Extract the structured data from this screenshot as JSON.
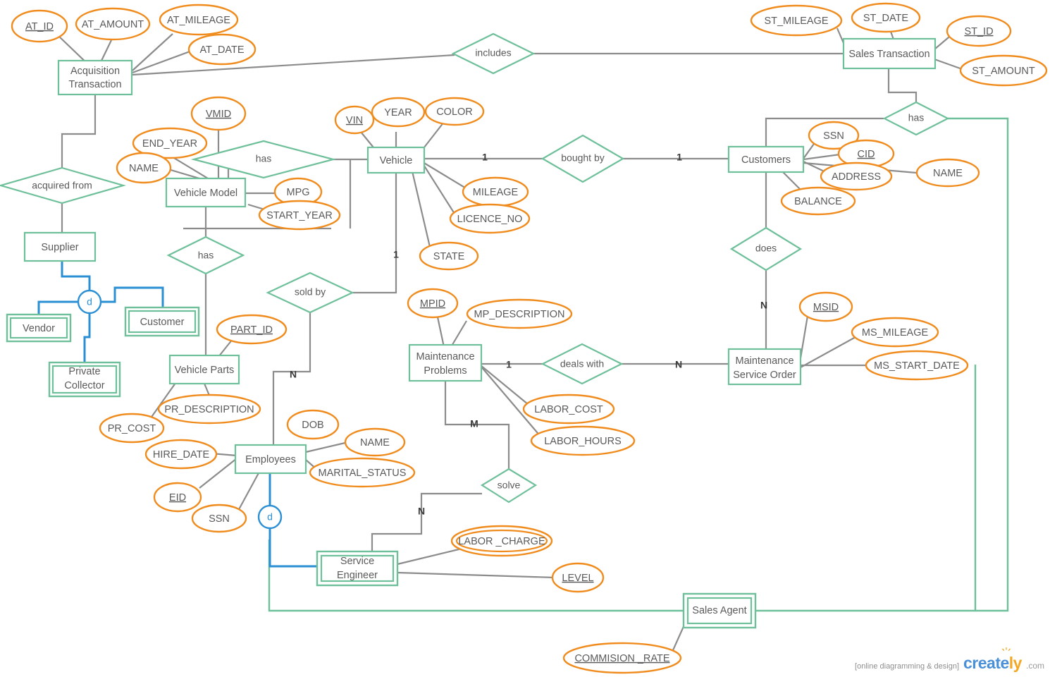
{
  "diagram": {
    "title": "Vehicle Dealership ER Diagram",
    "colors": {
      "entity_stroke": "#6ec09a",
      "attribute_stroke": "#f08c1e",
      "connector": "#8c8c8c",
      "specialization": "#2b8fd4",
      "text": "#5a5a5a"
    },
    "entities": [
      {
        "id": "acquisition_transaction",
        "label": "Acquisition\nTransaction",
        "line1": "Acquisition",
        "line2": "Transaction",
        "weak": false
      },
      {
        "id": "sales_transaction",
        "label": "Sales Transaction",
        "line1": "Sales Transaction",
        "line2": "",
        "weak": false
      },
      {
        "id": "vehicle_model",
        "label": "Vehicle Model",
        "line1": "Vehicle Model",
        "line2": "",
        "weak": false
      },
      {
        "id": "vehicle",
        "label": "Vehicle",
        "line1": "Vehicle",
        "line2": "",
        "weak": false
      },
      {
        "id": "customers",
        "label": "Customers",
        "line1": "Customers",
        "line2": "",
        "weak": false
      },
      {
        "id": "supplier",
        "label": "Supplier",
        "line1": "Supplier",
        "line2": "",
        "weak": false
      },
      {
        "id": "vendor",
        "label": "Vendor",
        "line1": "Vendor",
        "line2": "",
        "weak": true
      },
      {
        "id": "customer",
        "label": "Customer",
        "line1": "Customer",
        "line2": "",
        "weak": true
      },
      {
        "id": "private_collector",
        "label": "Private\nCollector",
        "line1": "Private",
        "line2": "Collector",
        "weak": true
      },
      {
        "id": "vehicle_parts",
        "label": "Vehicle Parts",
        "line1": "Vehicle Parts",
        "line2": "",
        "weak": false
      },
      {
        "id": "employees",
        "label": "Employees",
        "line1": "Employees",
        "line2": "",
        "weak": false
      },
      {
        "id": "maintenance_problems",
        "label": "Maintenance\nProblems",
        "line1": "Maintenance",
        "line2": "Problems",
        "weak": false
      },
      {
        "id": "maintenance_service_order",
        "label": "Maintenance\nService Order",
        "line1": "Maintenance",
        "line2": "Service Order",
        "weak": false
      },
      {
        "id": "service_engineer",
        "label": "Service\nEngineer",
        "line1": "Service",
        "line2": "Engineer",
        "weak": true
      },
      {
        "id": "sales_agent",
        "label": "Sales Agent",
        "line1": "Sales Agent",
        "line2": "",
        "weak": true
      }
    ],
    "relationships": [
      {
        "id": "includes",
        "label": "includes"
      },
      {
        "id": "has_sales_customers",
        "label": "has"
      },
      {
        "id": "acquired_from",
        "label": "acquired from"
      },
      {
        "id": "has_model_vehicle",
        "label": "has"
      },
      {
        "id": "bought_by",
        "label": "bought by"
      },
      {
        "id": "has_model_parts",
        "label": "has"
      },
      {
        "id": "sold_by",
        "label": "sold by"
      },
      {
        "id": "does",
        "label": "does"
      },
      {
        "id": "deals_with",
        "label": "deals with"
      },
      {
        "id": "solve",
        "label": "solve"
      }
    ],
    "attributes": [
      {
        "id": "at_id",
        "label": "AT_ID",
        "key": true,
        "multivalued": false,
        "owner": "acquisition_transaction"
      },
      {
        "id": "at_amount",
        "label": "AT_AMOUNT",
        "key": false,
        "multivalued": false,
        "owner": "acquisition_transaction"
      },
      {
        "id": "at_mileage",
        "label": "AT_MILEAGE",
        "key": false,
        "multivalued": false,
        "owner": "acquisition_transaction"
      },
      {
        "id": "at_date",
        "label": "AT_DATE",
        "key": false,
        "multivalued": false,
        "owner": "acquisition_transaction"
      },
      {
        "id": "st_mileage",
        "label": "ST_MILEAGE",
        "key": false,
        "multivalued": false,
        "owner": "sales_transaction"
      },
      {
        "id": "st_date",
        "label": "ST_DATE",
        "key": false,
        "multivalued": false,
        "owner": "sales_transaction"
      },
      {
        "id": "st_id",
        "label": "ST_ID",
        "key": true,
        "multivalued": false,
        "owner": "sales_transaction"
      },
      {
        "id": "st_amount",
        "label": "ST_AMOUNT",
        "key": false,
        "multivalued": false,
        "owner": "sales_transaction"
      },
      {
        "id": "vmid",
        "label": "VMID",
        "key": true,
        "multivalued": false,
        "owner": "vehicle_model"
      },
      {
        "id": "end_year",
        "label": "END_YEAR",
        "key": false,
        "multivalued": false,
        "owner": "vehicle_model"
      },
      {
        "id": "name_vm",
        "label": "NAME",
        "key": false,
        "multivalued": false,
        "owner": "vehicle_model"
      },
      {
        "id": "mpg",
        "label": "MPG",
        "key": false,
        "multivalued": false,
        "owner": "vehicle_model"
      },
      {
        "id": "start_year",
        "label": "START_YEAR",
        "key": false,
        "multivalued": false,
        "owner": "vehicle_model"
      },
      {
        "id": "vin",
        "label": "VIN",
        "key": true,
        "multivalued": false,
        "owner": "vehicle"
      },
      {
        "id": "year",
        "label": "YEAR",
        "key": false,
        "multivalued": false,
        "owner": "vehicle"
      },
      {
        "id": "color",
        "label": "COLOR",
        "key": false,
        "multivalued": false,
        "owner": "vehicle"
      },
      {
        "id": "mileage",
        "label": "MILEAGE",
        "key": false,
        "multivalued": false,
        "owner": "vehicle"
      },
      {
        "id": "licence_no",
        "label": "LICENCE_NO",
        "key": false,
        "multivalued": false,
        "owner": "vehicle"
      },
      {
        "id": "state",
        "label": "STATE",
        "key": false,
        "multivalued": false,
        "owner": "vehicle"
      },
      {
        "id": "ssn_cust",
        "label": "SSN",
        "key": false,
        "multivalued": false,
        "owner": "customers"
      },
      {
        "id": "cid",
        "label": "CID",
        "key": true,
        "multivalued": false,
        "owner": "customers"
      },
      {
        "id": "address",
        "label": "ADDRESS",
        "key": false,
        "multivalued": false,
        "owner": "customers"
      },
      {
        "id": "name_cust",
        "label": "NAME",
        "key": false,
        "multivalued": false,
        "owner": "customers"
      },
      {
        "id": "balance",
        "label": "BALANCE",
        "key": false,
        "multivalued": false,
        "owner": "customers"
      },
      {
        "id": "part_id",
        "label": "PART_ID",
        "key": true,
        "multivalued": false,
        "owner": "vehicle_parts"
      },
      {
        "id": "pr_description",
        "label": "PR_DESCRIPTION",
        "key": false,
        "multivalued": false,
        "owner": "vehicle_parts"
      },
      {
        "id": "pr_cost",
        "label": "PR_COST",
        "key": false,
        "multivalued": false,
        "owner": "vehicle_parts"
      },
      {
        "id": "dob",
        "label": "DOB",
        "key": false,
        "multivalued": false,
        "owner": "employees"
      },
      {
        "id": "name_emp",
        "label": "NAME",
        "key": false,
        "multivalued": false,
        "owner": "employees"
      },
      {
        "id": "marital_status",
        "label": "MARITAL_STATUS",
        "key": false,
        "multivalued": false,
        "owner": "employees"
      },
      {
        "id": "hire_date",
        "label": "HIRE_DATE",
        "key": false,
        "multivalued": false,
        "owner": "employees"
      },
      {
        "id": "eid",
        "label": "EID",
        "key": true,
        "multivalued": false,
        "owner": "employees"
      },
      {
        "id": "ssn_emp",
        "label": "SSN",
        "key": false,
        "multivalued": false,
        "owner": "employees"
      },
      {
        "id": "mpid",
        "label": "MPID",
        "key": true,
        "multivalued": false,
        "owner": "maintenance_problems"
      },
      {
        "id": "mp_description",
        "label": "MP_DESCRIPTION",
        "key": false,
        "multivalued": false,
        "owner": "maintenance_problems"
      },
      {
        "id": "labor_cost",
        "label": "LABOR_COST",
        "key": false,
        "multivalued": false,
        "owner": "maintenance_problems"
      },
      {
        "id": "labor_hours",
        "label": "LABOR_HOURS",
        "key": false,
        "multivalued": false,
        "owner": "maintenance_problems"
      },
      {
        "id": "msid",
        "label": "MSID",
        "key": true,
        "multivalued": false,
        "owner": "maintenance_service_order"
      },
      {
        "id": "ms_mileage",
        "label": "MS_MILEAGE",
        "key": false,
        "multivalued": false,
        "owner": "maintenance_service_order"
      },
      {
        "id": "ms_start_date",
        "label": "MS_START_DATE",
        "key": false,
        "multivalued": false,
        "owner": "maintenance_service_order"
      },
      {
        "id": "labor_charge",
        "label": "LABOR _CHARGE",
        "key": false,
        "multivalued": true,
        "owner": "service_engineer"
      },
      {
        "id": "level",
        "label": "LEVEL",
        "key": true,
        "multivalued": false,
        "owner": "service_engineer"
      },
      {
        "id": "commision_rate",
        "label": "COMMISION _RATE",
        "key": true,
        "multivalued": false,
        "owner": "sales_agent"
      }
    ],
    "specializations": [
      {
        "id": "supplier-d",
        "symbol": "d",
        "parent": "supplier",
        "children": [
          "vendor",
          "customer",
          "private_collector"
        ]
      },
      {
        "id": "employees-d",
        "symbol": "d",
        "parent": "employees",
        "children": [
          "service_engineer",
          "sales_agent"
        ]
      }
    ],
    "cardinalities": [
      {
        "id": "card-vehicle-boughtby",
        "value": "1"
      },
      {
        "id": "card-boughtby-customers",
        "value": "1"
      },
      {
        "id": "card-vehicle-soldby",
        "value": "1"
      },
      {
        "id": "card-soldby-employees",
        "value": "N"
      },
      {
        "id": "card-customers-does",
        "value": "N"
      },
      {
        "id": "card-mp-dealswith",
        "value": "1"
      },
      {
        "id": "card-dealswith-mso",
        "value": "N"
      },
      {
        "id": "card-mp-solve",
        "value": "M"
      },
      {
        "id": "card-solve-se",
        "value": "N"
      }
    ]
  },
  "watermark": {
    "tagline": "[online diagramming & design]",
    "brand_part1": "create",
    "brand_part2": "ly",
    "suffix": ".com"
  }
}
